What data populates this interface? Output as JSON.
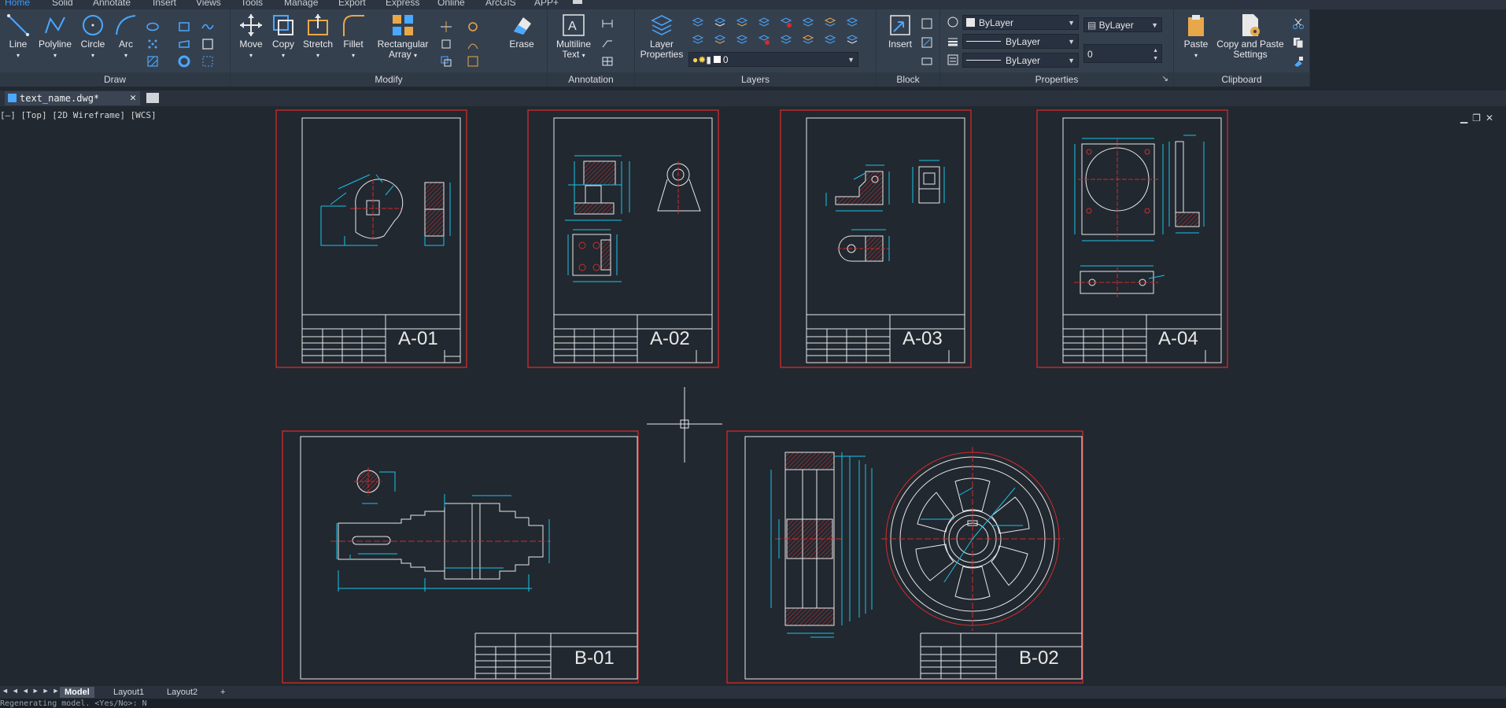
{
  "menu_tabs": [
    "Home",
    "Solid",
    "Annotate",
    "Insert",
    "Views",
    "Tools",
    "Manage",
    "Export",
    "Express",
    "Online",
    "ArcGIS",
    "APP+"
  ],
  "ribbon": {
    "draw": {
      "title": "Draw",
      "line": "Line",
      "polyline": "Polyline",
      "circle": "Circle",
      "arc": "Arc"
    },
    "modify": {
      "title": "Modify",
      "move": "Move",
      "copy": "Copy",
      "stretch": "Stretch",
      "fillet": "Fillet",
      "rect_array_1": "Rectangular",
      "rect_array_2": "Array",
      "erase": "Erase"
    },
    "annotation": {
      "title": "Annotation",
      "mtext_1": "Multiline",
      "mtext_2": "Text"
    },
    "layers": {
      "title": "Layers",
      "layer_props_1": "Layer",
      "layer_props_2": "Properties",
      "current_layer": "0"
    },
    "block": {
      "title": "Block",
      "insert": "Insert"
    },
    "properties": {
      "title": "Properties",
      "color": "ByLayer",
      "linetype": "ByLayer",
      "lineweight": "ByLayer",
      "plotstyle": "ByLayer",
      "transparency": "0"
    },
    "clipboard": {
      "title": "Clipboard",
      "paste": "Paste",
      "copy_paste_1": "Copy and Paste",
      "copy_paste_2": "Settings"
    }
  },
  "file_tab": {
    "name": "text_name.dwg*"
  },
  "viewport_label": "[—] [Top] [2D Wireframe] [WCS]",
  "sheets": [
    {
      "label": "A-01"
    },
    {
      "label": "A-02"
    },
    {
      "label": "A-03"
    },
    {
      "label": "A-04"
    },
    {
      "label": "B-01"
    },
    {
      "label": "B-02"
    }
  ],
  "layout_tabs": [
    "Model",
    "Layout1",
    "Layout2",
    "+"
  ],
  "command_line": "Regenerating model. <Yes/No>: N",
  "colors": {
    "accent": "#3f9bff",
    "sheet_border": "#d42a2a",
    "geometry": "#e8e8e8",
    "dimension": "#19c3e6",
    "hatch": "#b83434"
  }
}
